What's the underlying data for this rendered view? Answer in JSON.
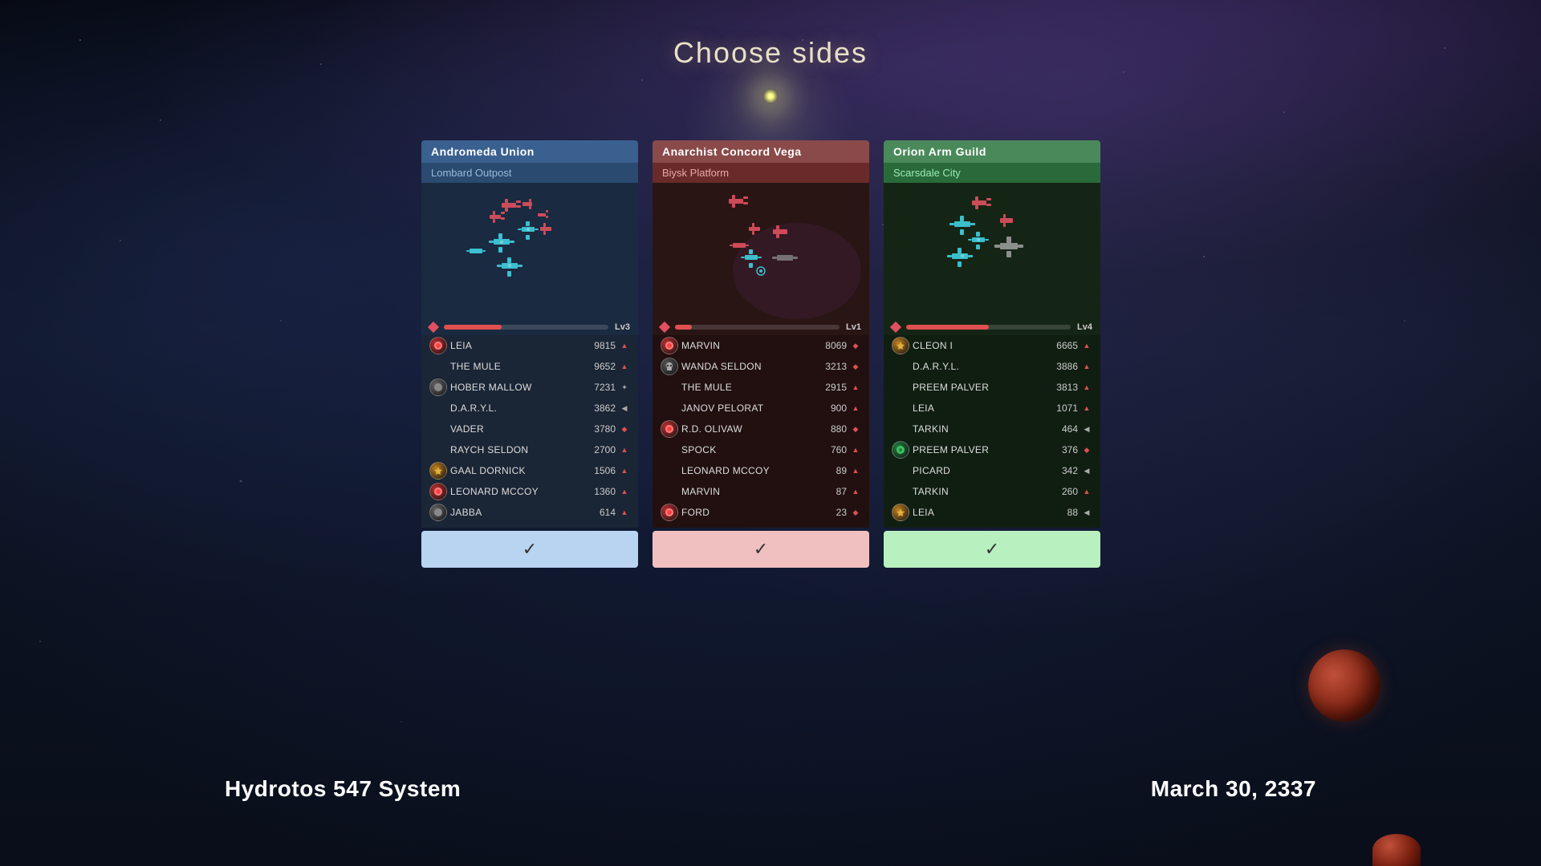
{
  "page": {
    "title": "Choose sides",
    "bottom_left": "Hydrotos 547 System",
    "bottom_right": "March 30, 2337"
  },
  "cards": [
    {
      "id": "andromeda",
      "faction": "Andromeda Union",
      "location": "Lombard Outpost",
      "level": "Lv3",
      "level_pct": 35,
      "confirm_label": "✓",
      "players": [
        {
          "name": "LEIA",
          "score": "9815",
          "avatar": "red",
          "icon": "▲"
        },
        {
          "name": "THE MULE",
          "score": "9652",
          "avatar": null,
          "icon": "▲"
        },
        {
          "name": "HOBER MALLOW",
          "score": "7231",
          "avatar": "gray",
          "icon": "✦"
        },
        {
          "name": "D.A.R.Y.L.",
          "score": "3862",
          "avatar": null,
          "icon": "◀"
        },
        {
          "name": "VADER",
          "score": "3780",
          "avatar": null,
          "icon": "◆"
        },
        {
          "name": "RAYCH SELDON",
          "score": "2700",
          "avatar": null,
          "icon": "▲"
        },
        {
          "name": "GAAL DORNICK",
          "score": "1506",
          "avatar": "gold",
          "icon": "▲"
        },
        {
          "name": "LEONARD MCCOY",
          "score": "1360",
          "avatar": "red",
          "icon": "▲"
        },
        {
          "name": "JABBA",
          "score": "614",
          "avatar": "gray",
          "icon": "▲"
        }
      ]
    },
    {
      "id": "anarchist",
      "faction": "Anarchist Concord Vega",
      "location": "Biysk Platform",
      "level": "Lv1",
      "level_pct": 10,
      "confirm_label": "✓",
      "players": [
        {
          "name": "MARVIN",
          "score": "8069",
          "avatar": "red",
          "icon": "◆"
        },
        {
          "name": "WANDA SELDON",
          "score": "3213",
          "avatar": "skull",
          "icon": "◆"
        },
        {
          "name": "THE MULE",
          "score": "2915",
          "avatar": null,
          "icon": "▲"
        },
        {
          "name": "JANOV PELORAT",
          "score": "900",
          "avatar": null,
          "icon": "▲"
        },
        {
          "name": "R.D. OLIVAW",
          "score": "880",
          "avatar": "red2",
          "icon": "◆"
        },
        {
          "name": "SPOCK",
          "score": "760",
          "avatar": null,
          "icon": "▲"
        },
        {
          "name": "LEONARD MCCOY",
          "score": "89",
          "avatar": null,
          "icon": "▲"
        },
        {
          "name": "MARVIN",
          "score": "87",
          "avatar": null,
          "icon": "▲"
        },
        {
          "name": "FORD",
          "score": "23",
          "avatar": "red",
          "icon": "◆"
        }
      ]
    },
    {
      "id": "orion",
      "faction": "Orion Arm Guild",
      "location": "Scarsdale City",
      "level": "Lv4",
      "level_pct": 50,
      "confirm_label": "✓",
      "players": [
        {
          "name": "CLEON I",
          "score": "6665",
          "avatar": "gold",
          "icon": "▲"
        },
        {
          "name": "D.A.R.Y.L.",
          "score": "3886",
          "avatar": null,
          "icon": "▲"
        },
        {
          "name": "PREEM PALVER",
          "score": "3813",
          "avatar": null,
          "icon": "▲"
        },
        {
          "name": "LEIA",
          "score": "1071",
          "avatar": null,
          "icon": "▲"
        },
        {
          "name": "TARKIN",
          "score": "464",
          "avatar": null,
          "icon": "◀"
        },
        {
          "name": "PREEM PALVER",
          "score": "376",
          "avatar": "green",
          "icon": "◆"
        },
        {
          "name": "PICARD",
          "score": "342",
          "avatar": null,
          "icon": "◀"
        },
        {
          "name": "TARKIN",
          "score": "260",
          "avatar": null,
          "icon": "▲"
        },
        {
          "name": "LEIA",
          "score": "88",
          "avatar": "gold",
          "icon": "◀"
        }
      ]
    }
  ]
}
